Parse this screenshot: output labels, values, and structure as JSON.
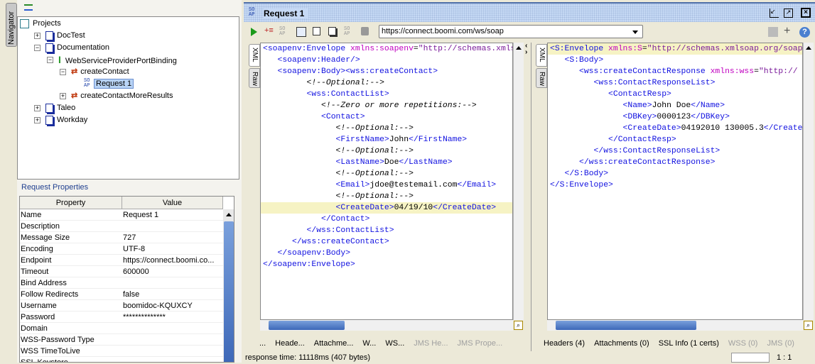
{
  "navigator": {
    "tab_label": "Navigator",
    "tree": [
      {
        "label": "Projects",
        "level": 0,
        "icon": "projects-icon"
      },
      {
        "label": "DocTest",
        "level": 1,
        "icon": "project-doc-icon",
        "toggle": "+"
      },
      {
        "label": "Documentation",
        "level": 1,
        "icon": "project-doc-icon",
        "toggle": "-"
      },
      {
        "label": "WebServiceProviderPortBinding",
        "level": 2,
        "icon": "interface-icon",
        "toggle": "-"
      },
      {
        "label": "createContact",
        "level": 3,
        "icon": "operation-icon",
        "toggle": "-"
      },
      {
        "label": "Request 1",
        "level": 4,
        "icon": "soap-request-icon",
        "selected": true
      },
      {
        "label": "createContactMoreResults",
        "level": 3,
        "icon": "operation-icon",
        "toggle": "+"
      },
      {
        "label": "Taleo",
        "level": 1,
        "icon": "project-doc-icon",
        "toggle": "+"
      },
      {
        "label": "Workday",
        "level": 1,
        "icon": "project-doc-icon",
        "toggle": "+"
      }
    ]
  },
  "properties": {
    "title": "Request Properties",
    "columns": [
      "Property",
      "Value"
    ],
    "rows": [
      [
        "Name",
        "Request 1"
      ],
      [
        "Description",
        ""
      ],
      [
        "Message Size",
        "727"
      ],
      [
        "Encoding",
        "UTF-8"
      ],
      [
        "Endpoint",
        "https://connect.boomi.co..."
      ],
      [
        "Timeout",
        "600000"
      ],
      [
        "Bind Address",
        ""
      ],
      [
        "Follow Redirects",
        "false"
      ],
      [
        "Username",
        "boomidoc-KQUXCY"
      ],
      [
        "Password",
        "**************"
      ],
      [
        "Domain",
        ""
      ],
      [
        "WSS-Password Type",
        ""
      ],
      [
        "WSS TimeToLive",
        ""
      ],
      [
        "SSL Keystore",
        ""
      ]
    ]
  },
  "window": {
    "title": "Request 1",
    "soap_glyph": "SOAP",
    "endpoint": "https://connect.boomi.com/ws/soap"
  },
  "editor_tabs": [
    "XML",
    "Raw"
  ],
  "request_xml": [
    [
      [
        "tag",
        "<soapenv:Envelope "
      ],
      [
        "attr",
        "xmlns:soapenv"
      ],
      [
        "text",
        "="
      ],
      [
        "val",
        "\"http://schemas.xmlsoap.org/soap/envelope/\""
      ]
    ],
    [
      [
        "text",
        "   "
      ],
      [
        "tag",
        "<soapenv:Header/>"
      ]
    ],
    [
      [
        "text",
        "   "
      ],
      [
        "tag",
        "<soapenv:Body><wss:createContact>"
      ]
    ],
    [
      [
        "text",
        "         "
      ],
      [
        "comment",
        "<!--Optional:-->"
      ]
    ],
    [
      [
        "text",
        "         "
      ],
      [
        "tag",
        "<wss:ContactList>"
      ]
    ],
    [
      [
        "text",
        "            "
      ],
      [
        "comment",
        "<!--Zero or more repetitions:-->"
      ]
    ],
    [
      [
        "text",
        "            "
      ],
      [
        "tag",
        "<Contact>"
      ]
    ],
    [
      [
        "text",
        "               "
      ],
      [
        "comment",
        "<!--Optional:-->"
      ]
    ],
    [
      [
        "text",
        "               "
      ],
      [
        "tag",
        "<FirstName>"
      ],
      [
        "text",
        "John"
      ],
      [
        "tag",
        "</FirstName>"
      ]
    ],
    [
      [
        "text",
        "               "
      ],
      [
        "comment",
        "<!--Optional:-->"
      ]
    ],
    [
      [
        "text",
        "               "
      ],
      [
        "tag",
        "<LastName>"
      ],
      [
        "text",
        "Doe"
      ],
      [
        "tag",
        "</LastName>"
      ]
    ],
    [
      [
        "text",
        "               "
      ],
      [
        "comment",
        "<!--Optional:-->"
      ]
    ],
    [
      [
        "text",
        "               "
      ],
      [
        "tag",
        "<Email>"
      ],
      [
        "text",
        "jdoe@testemail.com"
      ],
      [
        "tag",
        "</Email>"
      ]
    ],
    [
      [
        "text",
        "               "
      ],
      [
        "comment",
        "<!--Optional:-->"
      ]
    ],
    [
      [
        "text",
        "               "
      ],
      [
        "tag",
        "<CreateDate>"
      ],
      [
        "text",
        "04/19/10"
      ],
      [
        "tag",
        "</CreateDate>"
      ]
    ],
    [
      [
        "text",
        "            "
      ],
      [
        "tag",
        "</Contact>"
      ]
    ],
    [
      [
        "text",
        "         "
      ],
      [
        "tag",
        "</wss:ContactList>"
      ]
    ],
    [
      [
        "text",
        "      "
      ],
      [
        "tag",
        "</wss:createContact>"
      ]
    ],
    [
      [
        "text",
        "   "
      ],
      [
        "tag",
        "</soapenv:Body>"
      ]
    ],
    [
      [
        "tag",
        "</soapenv:Envelope>"
      ]
    ]
  ],
  "request_highlight_line": 14,
  "response_xml": [
    [
      [
        "tag",
        "<S:Envelope "
      ],
      [
        "attr",
        "xmlns:S"
      ],
      [
        "text",
        "="
      ],
      [
        "val",
        "\"http://schemas.xmlsoap.org/soap/envelope/\""
      ]
    ],
    [
      [
        "text",
        "   "
      ],
      [
        "tag",
        "<S:Body>"
      ]
    ],
    [
      [
        "text",
        "      "
      ],
      [
        "tag",
        "<wss:createContactResponse "
      ],
      [
        "attr",
        "xmlns:wss"
      ],
      [
        "text",
        "="
      ],
      [
        "val",
        "\"http://"
      ]
    ],
    [
      [
        "text",
        "         "
      ],
      [
        "tag",
        "<wss:ContactResponseList>"
      ]
    ],
    [
      [
        "text",
        "            "
      ],
      [
        "tag",
        "<ContactResp>"
      ]
    ],
    [
      [
        "text",
        "               "
      ],
      [
        "tag",
        "<Name>"
      ],
      [
        "text",
        "John Doe"
      ],
      [
        "tag",
        "</Name>"
      ]
    ],
    [
      [
        "text",
        "               "
      ],
      [
        "tag",
        "<DBKey>"
      ],
      [
        "text",
        "0000123"
      ],
      [
        "tag",
        "</DBKey>"
      ]
    ],
    [
      [
        "text",
        "               "
      ],
      [
        "tag",
        "<CreateDate>"
      ],
      [
        "text",
        "04192010 130005.3"
      ],
      [
        "tag",
        "</CreateDate>"
      ]
    ],
    [
      [
        "text",
        "            "
      ],
      [
        "tag",
        "</ContactResp>"
      ]
    ],
    [
      [
        "text",
        "         "
      ],
      [
        "tag",
        "</wss:ContactResponseList>"
      ]
    ],
    [
      [
        "text",
        "      "
      ],
      [
        "tag",
        "</wss:createContactResponse>"
      ]
    ],
    [
      [
        "text",
        "   "
      ],
      [
        "tag",
        "</S:Body>"
      ]
    ],
    [
      [
        "tag",
        "</S:Envelope>"
      ]
    ]
  ],
  "response_highlight_line": 0,
  "request_bottom_tabs": [
    {
      "label": "...",
      "enabled": true
    },
    {
      "label": "Heade...",
      "enabled": true
    },
    {
      "label": "Attachme...",
      "enabled": true
    },
    {
      "label": "W...",
      "enabled": true
    },
    {
      "label": "WS...",
      "enabled": true
    },
    {
      "label": "JMS He...",
      "enabled": false
    },
    {
      "label": "JMS Prope...",
      "enabled": false
    }
  ],
  "response_bottom_tabs": [
    {
      "label": "Headers (4)",
      "enabled": true
    },
    {
      "label": "Attachments (0)",
      "enabled": true
    },
    {
      "label": "SSL Info (1 certs)",
      "enabled": true
    },
    {
      "label": "WSS (0)",
      "enabled": false
    },
    {
      "label": "JMS (0)",
      "enabled": false
    }
  ],
  "status": {
    "response_time": "response time: 11118ms (407 bytes)",
    "position": "1 : 1"
  },
  "colors": {
    "tag": "#1010e0",
    "attr": "#c000c0",
    "value": "#7a1a9a",
    "titlebar": "#c6d9f5",
    "highlight": "#f6f3c4"
  }
}
